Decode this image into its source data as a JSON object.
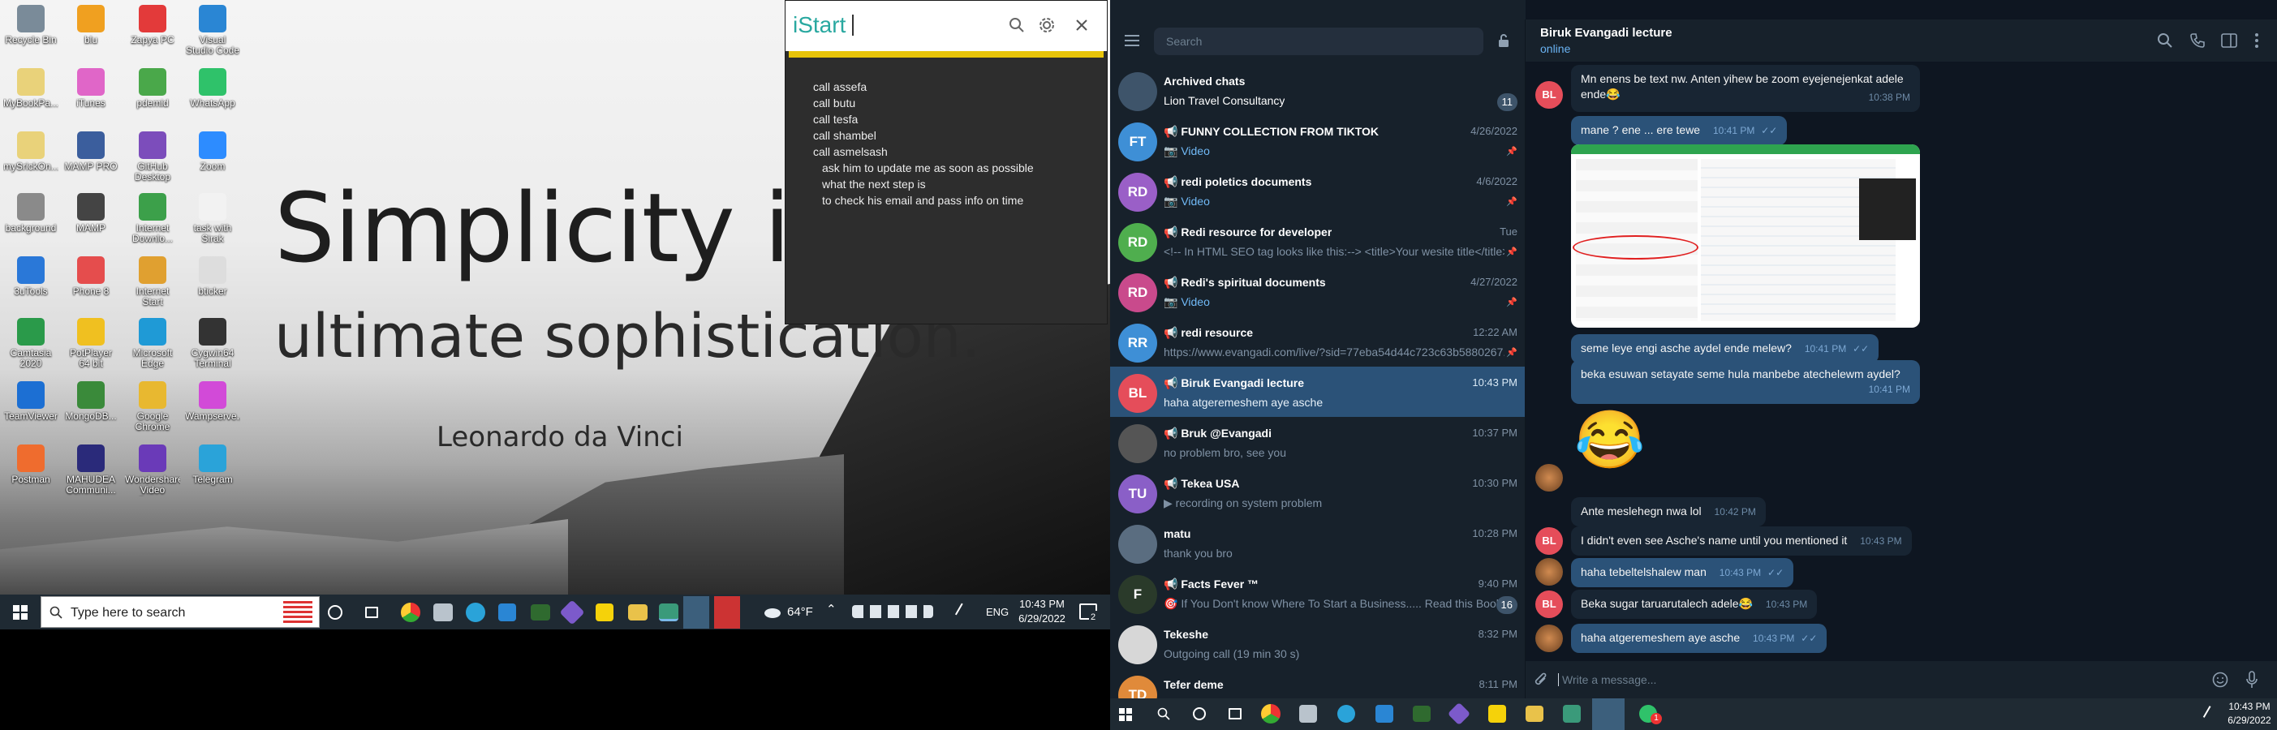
{
  "left_screen": {
    "wallpaper_quote": {
      "line1": "Simplicity is th",
      "line2": "ultimate sophistication.",
      "author": "Leonardo da Vinci"
    },
    "desktop_icons": [
      {
        "label": "Recycle Bin",
        "color": "#7a8b99"
      },
      {
        "label": "blu",
        "color": "#f0a020"
      },
      {
        "label": "Zapya PC",
        "color": "#e33a3a"
      },
      {
        "label": "Visual Studio Code",
        "color": "#2a86d4"
      },
      {
        "label": "MyBookPa...",
        "color": "#e9d27a"
      },
      {
        "label": "iTunes",
        "color": "#e066c8"
      },
      {
        "label": "pdemid",
        "color": "#4aa84a"
      },
      {
        "label": "WhatsApp",
        "color": "#2fc26a"
      },
      {
        "label": "mySrickOn...",
        "color": "#e9d27a"
      },
      {
        "label": "MAMP PRO",
        "color": "#3b5e9d"
      },
      {
        "label": "GitHub Desktop",
        "color": "#7c4dbb"
      },
      {
        "label": "Zoom",
        "color": "#2d8cff"
      },
      {
        "label": "background",
        "color": "#8a8a8a"
      },
      {
        "label": "MAMP",
        "color": "#444"
      },
      {
        "label": "Internet Downlo...",
        "color": "#3ca04a"
      },
      {
        "label": "task with Sirak",
        "color": "#f2f2f2"
      },
      {
        "label": "3uTools",
        "color": "#2a78d8"
      },
      {
        "label": "Phone 8",
        "color": "#e54d4d"
      },
      {
        "label": "Internet Start",
        "color": "#e0a030"
      },
      {
        "label": "bticker",
        "color": "#dddddd"
      },
      {
        "label": "Camtasia 2020",
        "color": "#2a9a4a"
      },
      {
        "label": "PotPlayer 64 bit",
        "color": "#f0c020"
      },
      {
        "label": "Microsoft Edge",
        "color": "#1f9ad6"
      },
      {
        "label": "Cygwin64 Terminal",
        "color": "#333"
      },
      {
        "label": "TeamViewer",
        "color": "#1c6fd3"
      },
      {
        "label": "MongoDB...",
        "color": "#3a8a3a"
      },
      {
        "label": "Google Chrome",
        "color": "#e8b830"
      },
      {
        "label": "Wampserve...",
        "color": "#d24ad8"
      },
      {
        "label": "Postman",
        "color": "#ef6c2e"
      },
      {
        "label": "MAHUDEA Communi...",
        "color": "#2a2a7a"
      },
      {
        "label": "Wondershare Video Conv...",
        "color": "#6a3ab8"
      },
      {
        "label": "Telegram",
        "color": "#2aa3d9"
      }
    ],
    "istart": {
      "brand": "iStart",
      "note_lines": [
        {
          "text": "call assefa",
          "indent": false
        },
        {
          "text": "call butu",
          "indent": false
        },
        {
          "text": "call tesfa",
          "indent": false
        },
        {
          "text": "call shambel",
          "indent": false
        },
        {
          "text": "call asmelsash",
          "indent": false
        },
        {
          "text": "ask him to update me as soon as possible",
          "indent": true
        },
        {
          "text": "what the next step is",
          "indent": true
        },
        {
          "text": "to check his email and pass info on time",
          "indent": true
        }
      ]
    },
    "taskbar": {
      "search_placeholder": "Type here to search",
      "weather": "64°F",
      "language": "ENG",
      "time": "10:43 PM",
      "date": "6/29/2022",
      "notifications": "2"
    }
  },
  "telegram": {
    "search_placeholder": "Search",
    "chats": [
      {
        "avatar": "",
        "avatar_color": "#3e546a",
        "name": "Archived chats",
        "message": "Lion Travel Consultancy",
        "time": "",
        "badge": "11",
        "type": "archived"
      },
      {
        "avatar": "FT",
        "avatar_color": "#3e8fd6",
        "name": "📢 FUNNY COLLECTION FROM TIKTOK",
        "message": "📷 Video",
        "time": "4/26/2022",
        "pinned": true
      },
      {
        "avatar": "RD",
        "avatar_color": "#9a5fc7",
        "name": "📢 redi poletics documents",
        "message": "📷 Video",
        "time": "4/6/2022",
        "pinned": true
      },
      {
        "avatar": "RD",
        "avatar_color": "#4fae4e",
        "name": "📢 Redi resource for developer",
        "message": "<!-- In HTML SEO tag looks like this:--> <title>Your wesite title</title> ...",
        "time": "Tue",
        "pinned": true
      },
      {
        "avatar": "RD",
        "avatar_color": "#c94a8c",
        "name": "📢 Redi's spiritual documents",
        "message": "📷 Video",
        "time": "4/27/2022",
        "pinned": true
      },
      {
        "avatar": "RR",
        "avatar_color": "#3e8fd6",
        "name": "📢 redi resource",
        "message": "https://www.evangadi.com/live/?sid=77eba54d44c723c63b5880267...",
        "time": "12:22 AM",
        "pinned": true
      },
      {
        "avatar": "BL",
        "avatar_color": "#e54d5a",
        "name": "📢 Biruk Evangadi lecture",
        "message": "haha atgeremeshem aye asche",
        "time": "10:43 PM",
        "selected": true
      },
      {
        "avatar": "",
        "avatar_color": "#555",
        "name": "📢 Bruk @Evangadi",
        "message": "no problem bro, see you",
        "time": "10:37 PM"
      },
      {
        "avatar": "TU",
        "avatar_color": "#8a5fc7",
        "name": "📢 Tekea USA",
        "message": "▶ recording on  system problem",
        "time": "10:30 PM"
      },
      {
        "avatar": "",
        "avatar_color": "#5a6d80",
        "name": "matu",
        "message": "thank you bro",
        "time": "10:28 PM"
      },
      {
        "avatar": "F",
        "avatar_color": "#2a3a2a",
        "name": "📢 Facts Fever ™",
        "message": "🎯 If You Don't know Where To Start a Business..... Read this Books ...",
        "time": "9:40 PM",
        "badge": "16"
      },
      {
        "avatar": "",
        "avatar_color": "#d7d7d7",
        "name": "Tekeshe",
        "message": "Outgoing call (19 min 30 s)",
        "time": "8:32 PM"
      },
      {
        "avatar": "TD",
        "avatar_color": "#e08a3a",
        "name": "Tefer deme",
        "message": "",
        "time": "8:11 PM"
      }
    ],
    "conversation": {
      "title": "Biruk Evangadi lecture",
      "status": "online",
      "messages": [
        {
          "dir": "in",
          "avatar": "BL",
          "text": "Mn enens be text nw. Anten yihew be zoom eyejenejenkat adele ende😂",
          "time": "10:38 PM"
        },
        {
          "dir": "out",
          "text": "mane ? ene ... ere tewe",
          "time": "10:41 PM"
        },
        {
          "dir": "out",
          "text": "seme leye engi asche aydel ende melew?",
          "time": "10:41 PM"
        },
        {
          "dir": "out",
          "text": "beka esuwan setayate seme hula manbebe atechelewm aydel?",
          "time": "10:41 PM"
        },
        {
          "dir": "in",
          "text": "Ante meslehegn nwa lol",
          "time": "10:42 PM"
        },
        {
          "dir": "in",
          "avatar": "BL",
          "text": "I didn't even see Asche's name until you mentioned it",
          "time": "10:43 PM"
        },
        {
          "dir": "out",
          "text": "haha tebeltelshalew man",
          "time": "10:43 PM"
        },
        {
          "dir": "in",
          "avatar": "BL",
          "text": "Beka sugar taruarutalech adele😂",
          "time": "10:43 PM"
        },
        {
          "dir": "out",
          "text": "haha atgeremeshem aye asche",
          "time": "10:43 PM"
        }
      ],
      "emoji": "😂",
      "input_placeholder": "Write a message..."
    },
    "taskbar": {
      "time": "10:43 PM",
      "date": "6/29/2022",
      "telegram_badge": "1"
    }
  }
}
